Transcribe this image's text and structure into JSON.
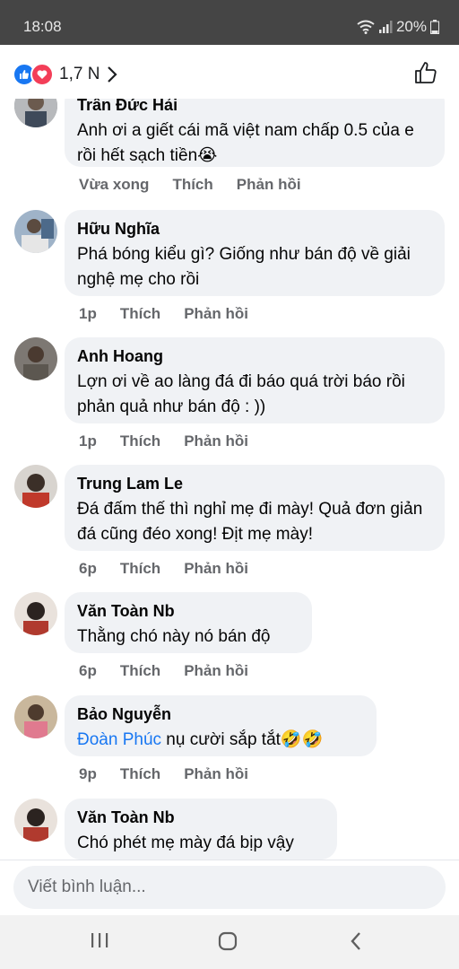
{
  "status": {
    "time": "18:08",
    "battery": "20%"
  },
  "header": {
    "reaction_count": "1,7 N"
  },
  "comments": [
    {
      "author": "Trần Đức Hải",
      "text": "Anh ơi a giết cái mã việt nam chấp 0.5 của e rồi hết sạch tiền😭",
      "time": "Vừa xong",
      "like": "Thích",
      "reply": "Phản hồi"
    },
    {
      "author": "Hữu Nghĩa",
      "text": "Phá bóng kiểu gì? Giống như bán độ về giải nghệ mẹ cho rồi",
      "time": "1p",
      "like": "Thích",
      "reply": "Phản hồi"
    },
    {
      "author": "Anh Hoang",
      "text": "Lợn ơi về ao làng đá đi báo quá trời báo rồi phản quả như bán độ : ))",
      "time": "1p",
      "like": "Thích",
      "reply": "Phản hồi"
    },
    {
      "author": "Trung Lam Le",
      "text": "Đá đấm thế thì nghỉ mẹ đi mày! Quả đơn giản đá cũng đéo xong! Địt mẹ mày!",
      "time": "6p",
      "like": "Thích",
      "reply": "Phản hồi"
    },
    {
      "author": "Văn Toàn Nb",
      "text": "Thằng chó này nó bán độ",
      "time": "6p",
      "like": "Thích",
      "reply": "Phản hồi"
    },
    {
      "author": "Bảo Nguyễn",
      "mention": "Đoàn Phúc",
      "text": " nụ cười sắp tắt🤣🤣",
      "time": "9p",
      "like": "Thích",
      "reply": "Phản hồi"
    },
    {
      "author": "Văn Toàn Nb",
      "text": "Chó phét mẹ mày đá bịp vậy"
    }
  ],
  "composer": {
    "placeholder": "Viết bình luận..."
  },
  "colors": {
    "accent": "#1877f2",
    "bubble": "#f0f2f5",
    "meta": "#65676b"
  }
}
